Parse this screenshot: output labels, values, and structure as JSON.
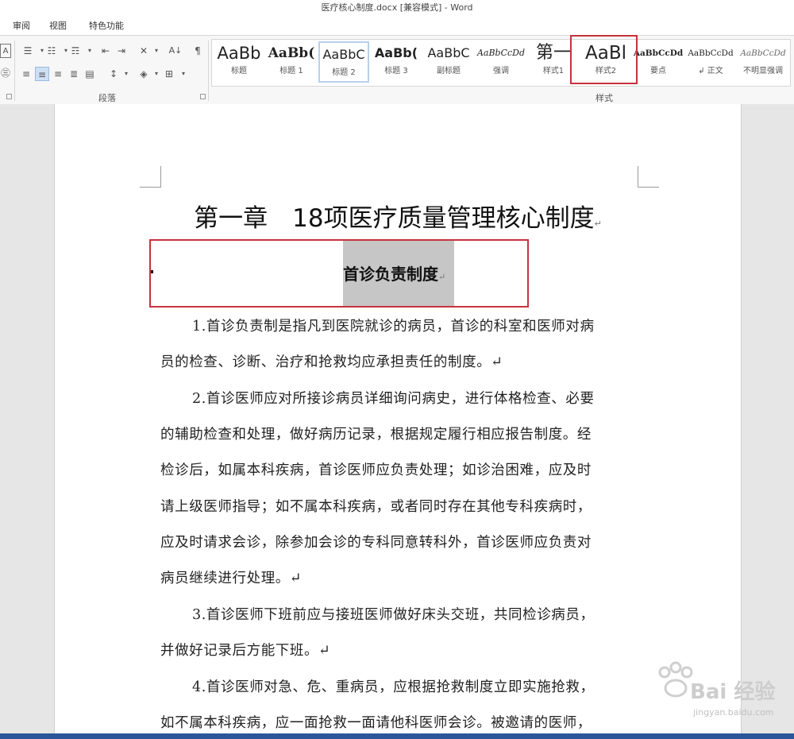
{
  "window": {
    "title": "医疗核心制度.docx [兼容模式] - Word"
  },
  "tabs": [
    "审阅",
    "视图",
    "特色功能"
  ],
  "ribbon": {
    "paragraph_group": "段落",
    "styles_group": "样式",
    "styles": [
      {
        "preview": "AaBb",
        "name": "标题"
      },
      {
        "preview": "AaBb(",
        "name": "标题 1"
      },
      {
        "preview": "AaBbC",
        "name": "标题 2"
      },
      {
        "preview": "AaBb(",
        "name": "标题 3"
      },
      {
        "preview": "AaBbC",
        "name": "副标题"
      },
      {
        "preview": "AaBbCcDd",
        "name": "强调"
      },
      {
        "preview": "第一",
        "name": "样式1"
      },
      {
        "preview": "AaBl",
        "name": "样式2"
      },
      {
        "preview": "AaBbCcDd",
        "name": "要点"
      },
      {
        "preview": "AaBbCcDd",
        "name": "↲ 正文"
      },
      {
        "preview": "AaBbCcDd",
        "name": "不明显强调"
      }
    ]
  },
  "document": {
    "title": "第一章　18项医疗质量管理核心制度",
    "heading": "首诊负责制度",
    "para_mark": "↵",
    "lines": [
      "1.首诊负责制是指凡到医院就诊的病员，首诊的科室和医师对病",
      "员的检查、诊断、治疗和抢救均应承担责任的制度。↵",
      "2.首诊医师应对所接诊病员详细询问病史，进行体格检查、必要",
      "的辅助检查和处理，做好病历记录，根据规定履行相应报告制度。经",
      "检诊后，如属本科疾病，首诊医师应负责处理；如诊治困难，应及时",
      "请上级医师指导；如不属本科疾病，或者同时存在其他专科疾病时，",
      "应及时请求会诊，除参加会诊的专科同意转科外，首诊医师应负责对",
      "病员继续进行处理。↵",
      "3.首诊医师下班前应与接班医师做好床头交班，共同检诊病员，",
      "并做好记录后方能下班。↵",
      "4.首诊医师对急、危、重病员，应根据抢救制度立即实施抢救，",
      "如不属本科疾病，应一面抢救一面请他科医师会诊。被邀请的医师，"
    ]
  },
  "watermark": {
    "text": "Bai 经验",
    "url": "jingyan.baidu.com"
  },
  "colors": {
    "highlight_box": "#c8323c",
    "statusbar": "#2b579a",
    "selection": "#c6c6c6"
  }
}
